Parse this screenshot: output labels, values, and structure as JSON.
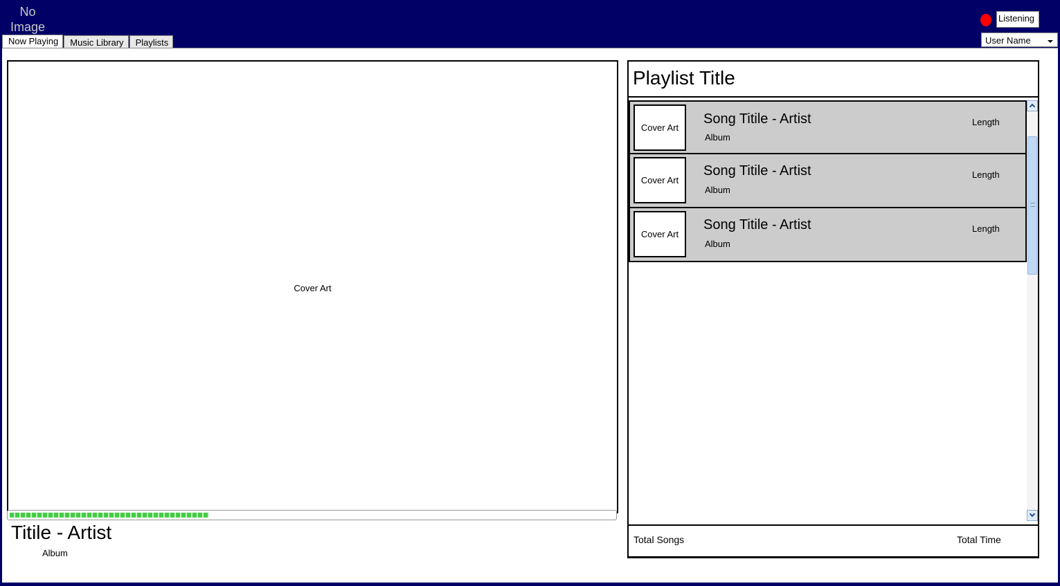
{
  "header": {
    "logo_text": "No Image",
    "status_label": "Listening",
    "status_color": "#ff0000",
    "user_select_value": "User Name",
    "background_color": "#000066"
  },
  "tabs": [
    {
      "label": "Now Playing",
      "active": true
    },
    {
      "label": "Music Library",
      "active": false
    },
    {
      "label": "Playlists",
      "active": false
    }
  ],
  "now_playing": {
    "cover_label": "Cover Art",
    "title": "Titile - Artist",
    "album": "Album",
    "progress_fraction": 0.33,
    "progress_color": "#44cc44"
  },
  "playlist": {
    "title": "Playlist Title",
    "songs": [
      {
        "cover_label": "Cover Art",
        "title": "Song Titile - Artist",
        "album": "Album",
        "length": "Length"
      },
      {
        "cover_label": "Cover Art",
        "title": "Song Titile - Artist",
        "album": "Album",
        "length": "Length"
      },
      {
        "cover_label": "Cover Art",
        "title": "Song Titile - Artist",
        "album": "Album",
        "length": "Length"
      }
    ],
    "row_color": "#cccccc",
    "footer": {
      "total_songs_label": "Total Songs",
      "total_time_label": "Total Time"
    }
  }
}
